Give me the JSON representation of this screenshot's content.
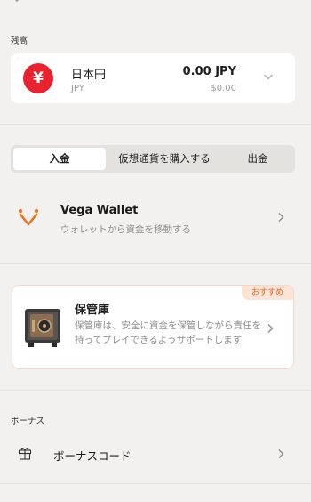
{
  "balance": {
    "section_label": "残高",
    "currency_symbol": "¥",
    "currency_name": "日本円",
    "currency_code": "JPY",
    "amount": "0.00 JPY",
    "amount_usd": "$0.00"
  },
  "tabs": [
    {
      "label": "入金",
      "active": true
    },
    {
      "label": "仮想通貨を購入する",
      "active": false
    },
    {
      "label": "出金",
      "active": false
    }
  ],
  "wallet": {
    "title": "Vega Wallet",
    "subtitle": "ウォレットから資金を移動する"
  },
  "vault": {
    "badge": "おすすめ",
    "title": "保管庫",
    "description": "保管庫は、安全に資金を保管しながら責任を持ってプレイできるようサポートします"
  },
  "bonus": {
    "section_label": "ボーナス",
    "code_label": "ボーナスコード"
  },
  "colors": {
    "brand_red": "#e8232f",
    "accent_orange": "#e8782e",
    "background": "#f3f1ef"
  }
}
